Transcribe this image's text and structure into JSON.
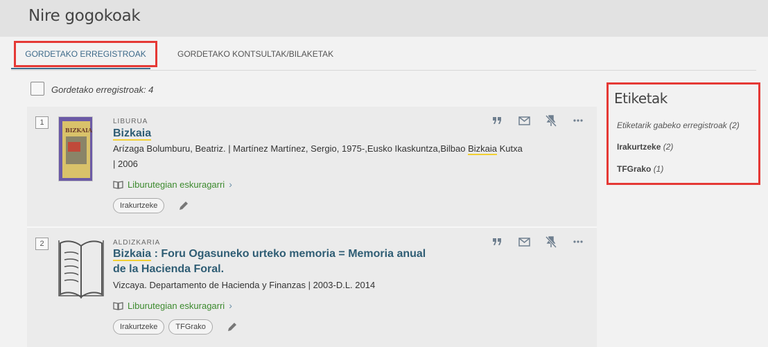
{
  "page": {
    "title": "Nire gogokoak"
  },
  "tabs": [
    {
      "label": "GORDETAKO ERREGISTROAK",
      "active": true
    },
    {
      "label": "GORDETAKO KONTSULTAK/BILAKETAK",
      "active": false
    }
  ],
  "list": {
    "count_label": "Gordetako erregistroak: 4"
  },
  "records": [
    {
      "number": "1",
      "type": "LIBURUA",
      "title_highlight": "Bizkaia",
      "title_rest": "",
      "meta_line1_pre": "Arízaga Bolumburu, Beatriz. | Martínez Martínez, Sergio, 1975-,Eusko Ikaskuntza,Bilbao ",
      "meta_line1_hl": "Bizkaia",
      "meta_line1_post": " Kutxa",
      "meta_line2": "| 2006",
      "availability": "Liburutegian eskuragarri",
      "tags": [
        "Irakurtzeke"
      ],
      "thumb_text": "BIZKAIA"
    },
    {
      "number": "2",
      "type": "ALDIZKARIA",
      "title_highlight": "Bizkaia",
      "title_rest": " : Foru Ogasuneko urteko memoria = Memoria anual",
      "title_line2": "de la Hacienda Foral.",
      "meta_line1": "Vizcaya. Departamento de Hacienda y Finanzas | 2003-D.L. 2014",
      "availability": "Liburutegian eskuragarri",
      "tags": [
        "Irakurtzeke",
        "TFGrako"
      ]
    }
  ],
  "actions": {
    "cite_icon": "quote-icon",
    "email_icon": "envelope-icon",
    "unpin_icon": "unpin-icon",
    "more_icon": "more-icon"
  },
  "sidebar": {
    "title": "Etiketak",
    "items": [
      {
        "label": "Etiketarik gabeko erregistroak",
        "count": "(2)"
      },
      {
        "label": "Irakurtzeke",
        "count": "(2)"
      },
      {
        "label": "TFGrako",
        "count": "(1)"
      }
    ]
  },
  "colors": {
    "accent": "#3d6a8a",
    "highlight_box": "#e53935",
    "available": "#3c8a2e",
    "title": "#2f5d74"
  }
}
